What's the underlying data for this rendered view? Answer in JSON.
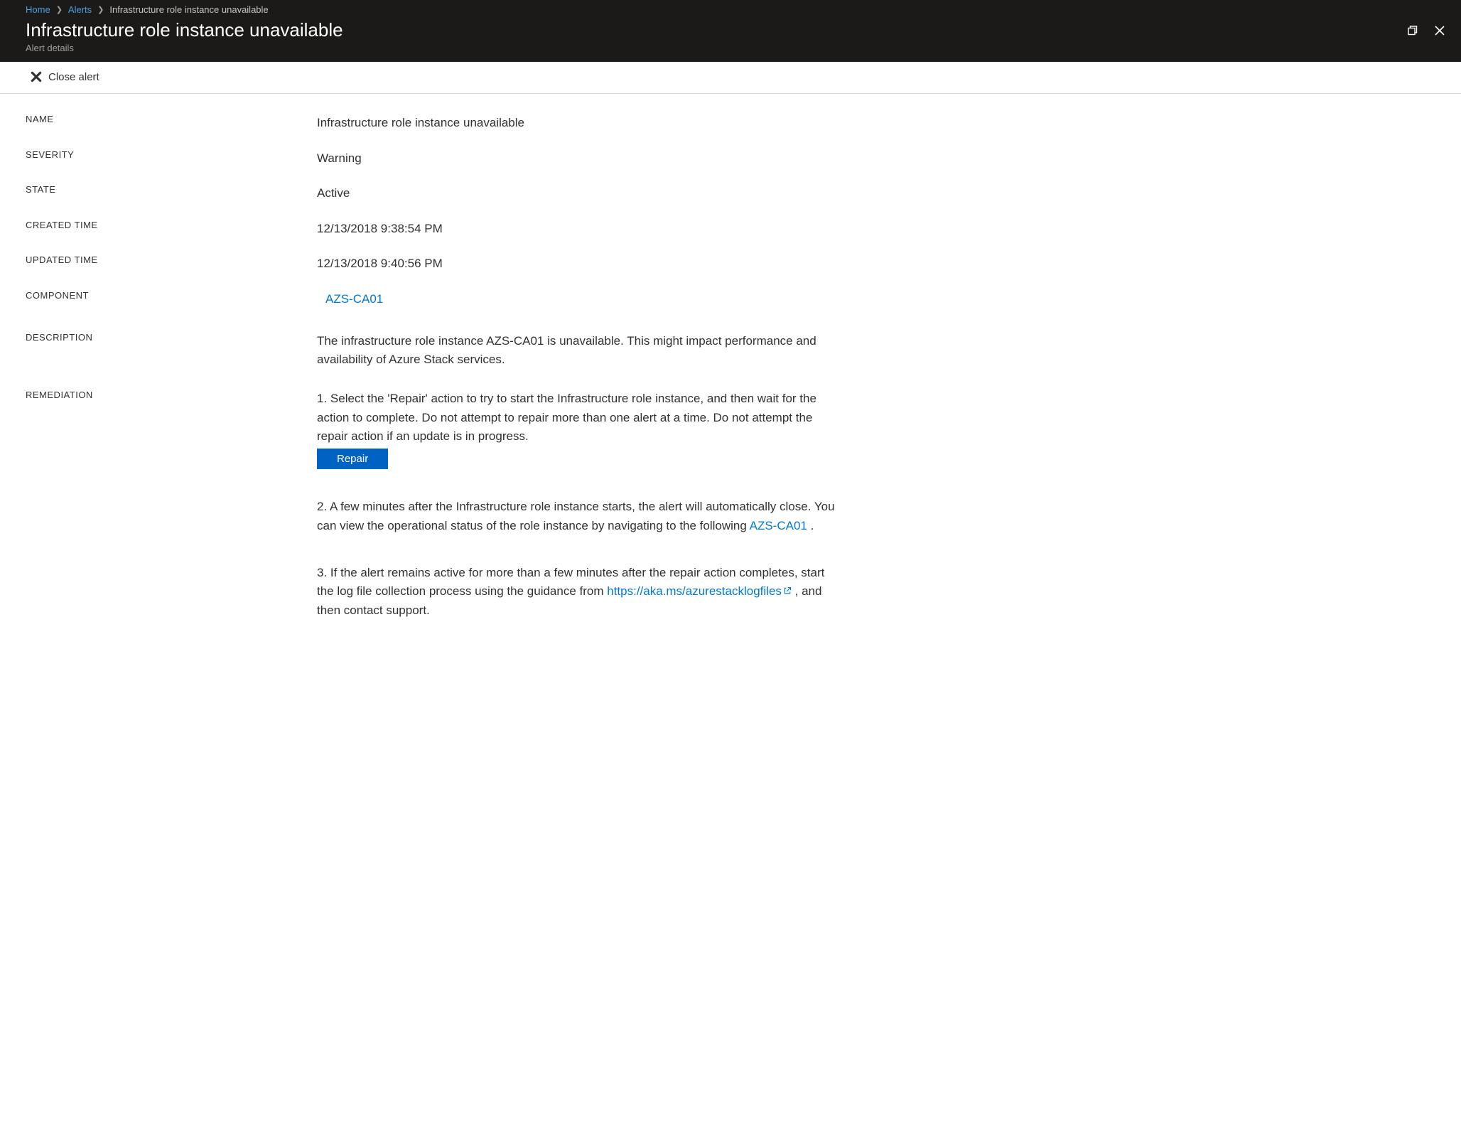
{
  "breadcrumb": {
    "home": "Home",
    "alerts": "Alerts",
    "current": "Infrastructure role instance unavailable"
  },
  "header": {
    "title": "Infrastructure role instance unavailable",
    "subtitle": "Alert details"
  },
  "toolbar": {
    "close_alert": "Close alert"
  },
  "labels": {
    "name": "NAME",
    "severity": "SEVERITY",
    "state": "STATE",
    "created_time": "CREATED TIME",
    "updated_time": "UPDATED TIME",
    "component": "COMPONENT",
    "description": "DESCRIPTION",
    "remediation": "REMEDIATION"
  },
  "values": {
    "name": "Infrastructure role instance unavailable",
    "severity": "Warning",
    "state": "Active",
    "created_time": "12/13/2018 9:38:54 PM",
    "updated_time": "12/13/2018 9:40:56 PM",
    "component": "AZS-CA01",
    "description": "The infrastructure role instance AZS-CA01 is unavailable. This might impact performance and availability of Azure Stack services."
  },
  "remediation": {
    "step1": "1. Select the 'Repair' action to try to start the Infrastructure role instance, and then wait for the action to complete. Do not attempt to repair more than one alert at a time. Do not attempt the repair action if an update is in progress.",
    "repair_button": "Repair",
    "step2_a": "2. A few minutes after the Infrastructure role instance starts, the alert will automatically close. You can view the operational status of the role instance by navigating to the following ",
    "step2_link": "AZS-CA01",
    "step2_b": " .",
    "step3_a": "3. If the alert remains active for more than a few minutes after the repair action completes, start the log file collection process using the guidance from ",
    "step3_link": "https://aka.ms/azurestacklogfiles",
    "step3_b": " , and then contact support."
  }
}
